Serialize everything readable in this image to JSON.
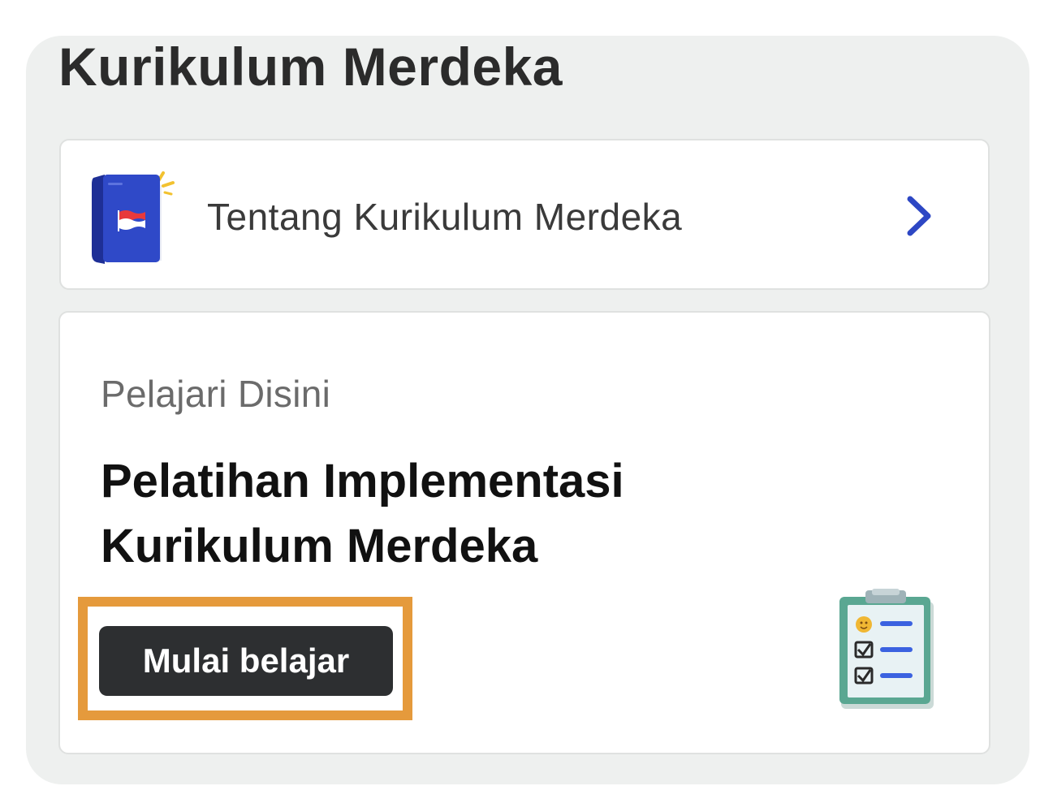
{
  "section": {
    "title": "Kurikulum Merdeka"
  },
  "about_card": {
    "label": "Tentang Kurikulum Merdeka",
    "icon": "book-icon",
    "chevron_icon": "chevron-right-icon"
  },
  "learn_card": {
    "eyebrow": "Pelajari Disini",
    "title": "Pelatihan Implementasi Kurikulum Merdeka",
    "button_label": "Mulai belajar",
    "illustration": "clipboard-icon"
  },
  "colors": {
    "panel_bg": "#eef0ef",
    "book_blue": "#2f49c8",
    "chevron_blue": "#2d47c4",
    "button_dark": "#2d2f31",
    "highlight_orange": "#e59a3c"
  }
}
